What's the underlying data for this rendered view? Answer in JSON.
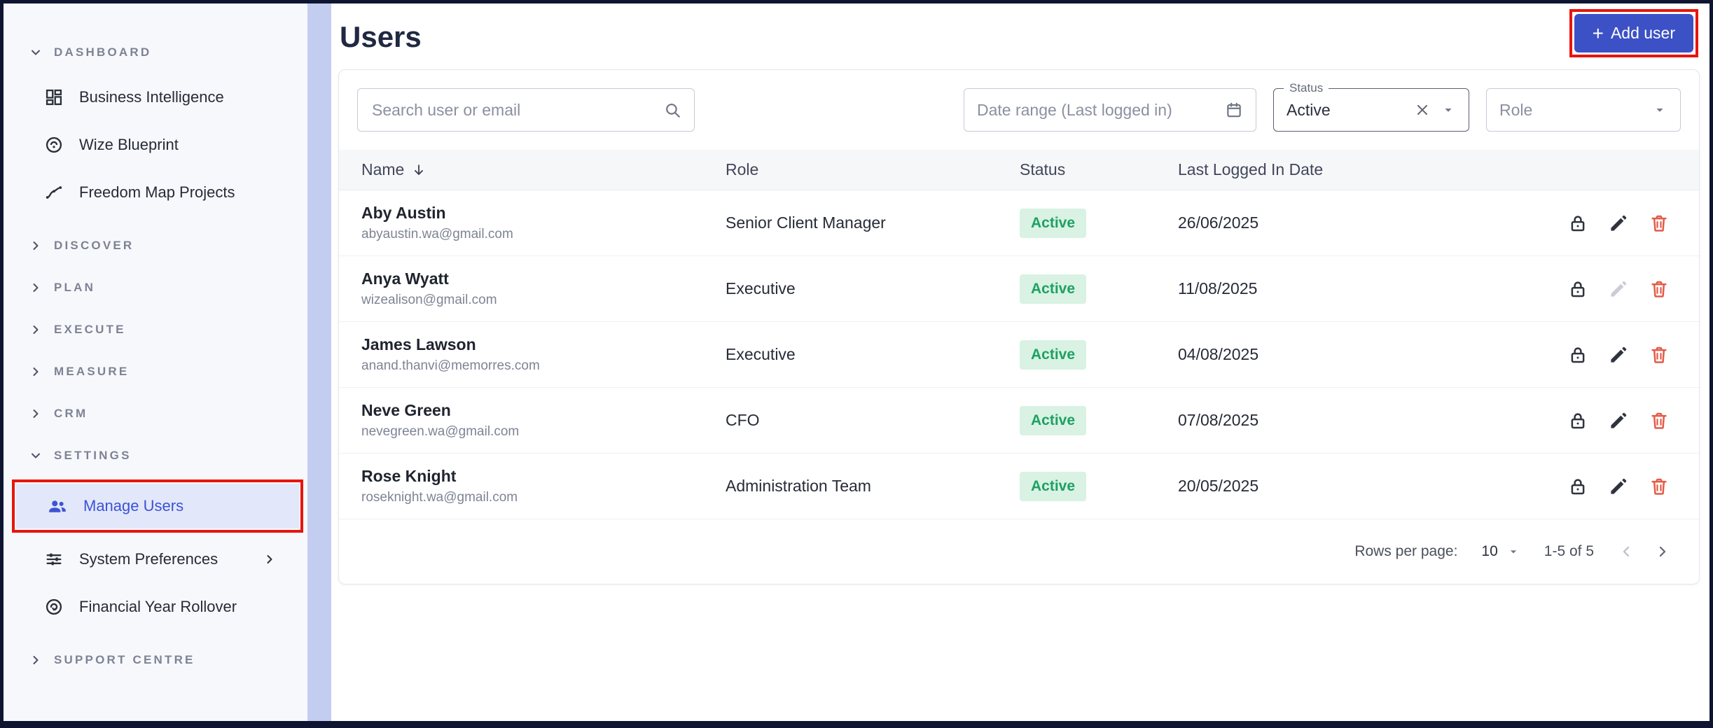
{
  "colors": {
    "accent": "#3c51c5",
    "selected_text": "#3d52d5",
    "active_badge_bg": "#d9f2e3",
    "active_badge_text": "#1ea163",
    "annotation_red": "#e8150d",
    "trash_icon": "#e45b47",
    "side_strip": "#c3cdf0"
  },
  "sidebar": {
    "sections": {
      "dashboard": {
        "label": "DASHBOARD",
        "expanded": true
      },
      "discover": {
        "label": "DISCOVER"
      },
      "plan": {
        "label": "PLAN"
      },
      "execute": {
        "label": "EXECUTE"
      },
      "measure": {
        "label": "MEASURE"
      },
      "crm": {
        "label": "CRM"
      },
      "settings": {
        "label": "SETTINGS",
        "expanded": true
      },
      "support": {
        "label": "SUPPORT CENTRE"
      }
    },
    "dashboard_items": [
      {
        "label": "Business Intelligence",
        "icon": "dashboard-grid-icon"
      },
      {
        "label": "Wize Blueprint",
        "icon": "blueprint-icon"
      },
      {
        "label": "Freedom Map Projects",
        "icon": "route-icon"
      }
    ],
    "settings_items": [
      {
        "label": "Manage Users",
        "icon": "people-icon",
        "selected": true
      },
      {
        "label": "System Preferences",
        "icon": "sliders-icon",
        "has_submenu": true
      },
      {
        "label": "Financial Year Rollover",
        "icon": "rollover-icon"
      }
    ]
  },
  "header": {
    "title": "Users",
    "plus": "+",
    "add_user_label": "Add user"
  },
  "filters": {
    "search_placeholder": "Search user or email",
    "date_range_placeholder": "Date range (Last logged in)",
    "status_label": "Status",
    "status_value": "Active",
    "role_label": "Role"
  },
  "table": {
    "columns": {
      "name": "Name",
      "role": "Role",
      "status": "Status",
      "last_logged": "Last Logged In Date"
    },
    "rows": [
      {
        "name": "Aby Austin",
        "email": "abyaustin.wa@gmail.com",
        "role": "Senior Client Manager",
        "status": "Active",
        "last_logged": "26/06/2025"
      },
      {
        "name": "Anya Wyatt",
        "email": "wizealison@gmail.com",
        "role": "Executive",
        "status": "Active",
        "last_logged": "11/08/2025"
      },
      {
        "name": "James Lawson",
        "email": "anand.thanvi@memorres.com",
        "role": "Executive",
        "status": "Active",
        "last_logged": "04/08/2025"
      },
      {
        "name": "Neve Green",
        "email": "nevegreen.wa@gmail.com",
        "role": "CFO",
        "status": "Active",
        "last_logged": "07/08/2025"
      },
      {
        "name": "Rose Knight",
        "email": "roseknight.wa@gmail.com",
        "role": "Administration Team",
        "status": "Active",
        "last_logged": "20/05/2025"
      }
    ]
  },
  "pagination": {
    "rows_per_page_label": "Rows per page:",
    "rows_per_page_value": "10",
    "range_label": "1-5 of 5"
  }
}
